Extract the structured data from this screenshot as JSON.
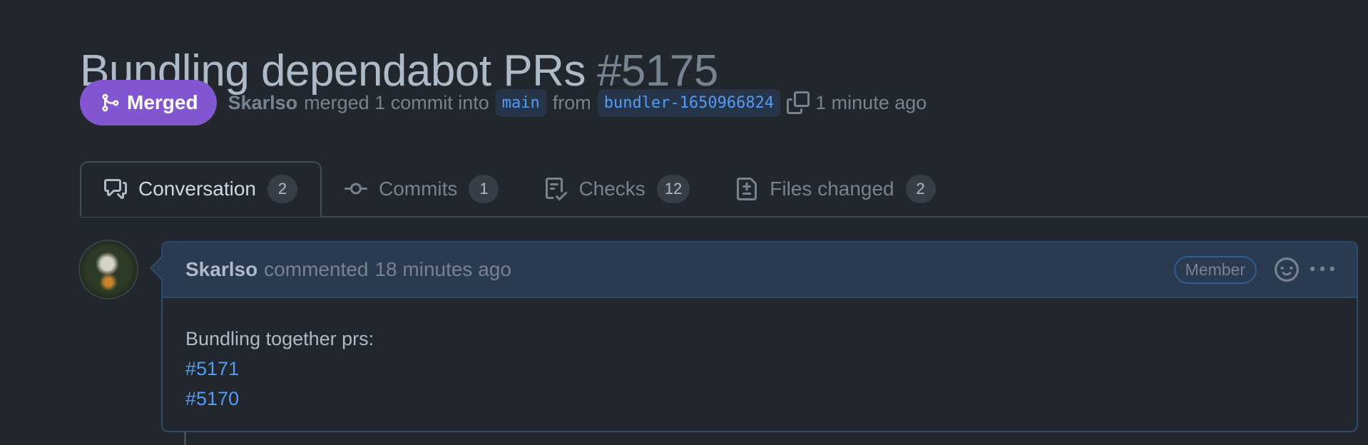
{
  "pr": {
    "title": "Bundling dependabot PRs",
    "number": "#5175"
  },
  "meta": {
    "state": "Merged",
    "author": "Skarlso",
    "action": "merged 1 commit into",
    "base_branch": "main",
    "from_text": "from",
    "head_branch": "bundler-1650966824",
    "time": "1 minute ago"
  },
  "tabs": [
    {
      "label": "Conversation",
      "count": "2",
      "icon": "comment-discussion-icon"
    },
    {
      "label": "Commits",
      "count": "1",
      "icon": "git-commit-icon"
    },
    {
      "label": "Checks",
      "count": "12",
      "icon": "checklist-icon"
    },
    {
      "label": "Files changed",
      "count": "2",
      "icon": "file-diff-icon"
    }
  ],
  "comment": {
    "author": "Skarlso",
    "verb": "commented",
    "time": "18 minutes ago",
    "role": "Member",
    "body_text": "Bundling together prs:",
    "links": [
      "#5171",
      "#5170"
    ]
  },
  "colors": {
    "background": "#22272e",
    "merged_badge": "#8256d0",
    "link": "#539bf5",
    "comment_header": "#2a3a50"
  }
}
